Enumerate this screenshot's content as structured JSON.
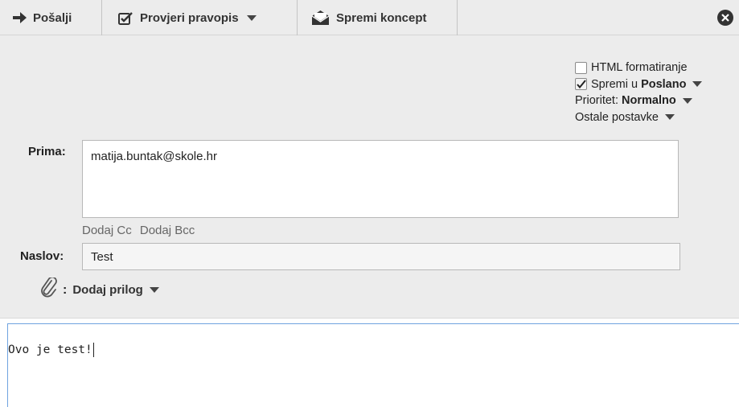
{
  "toolbar": {
    "send_label": "Pošalji",
    "spellcheck_label": "Provjeri pravopis",
    "save_draft_label": "Spremi koncept"
  },
  "options": {
    "html_format_label": "HTML formatiranje",
    "html_format_checked": false,
    "save_sent_prefix": "Spremi u",
    "save_sent_folder": "Poslano",
    "save_sent_checked": true,
    "priority_label": "Prioritet:",
    "priority_value": "Normalno",
    "other_options_label": "Ostale postavke"
  },
  "compose": {
    "to_label": "Prima:",
    "to_value": "matija.buntak@skole.hr",
    "add_cc": "Dodaj Cc",
    "add_bcc": "Dodaj Bcc",
    "subject_label": "Naslov:",
    "subject_value": "Test",
    "attach_colon": ":",
    "add_attachment": "Dodaj prilog",
    "body_text": "Ovo je test!"
  },
  "colors": {
    "toolbar_bg": "#ececec",
    "header_bg": "#ececec",
    "editor_focus_border": "#6fa3e0"
  }
}
